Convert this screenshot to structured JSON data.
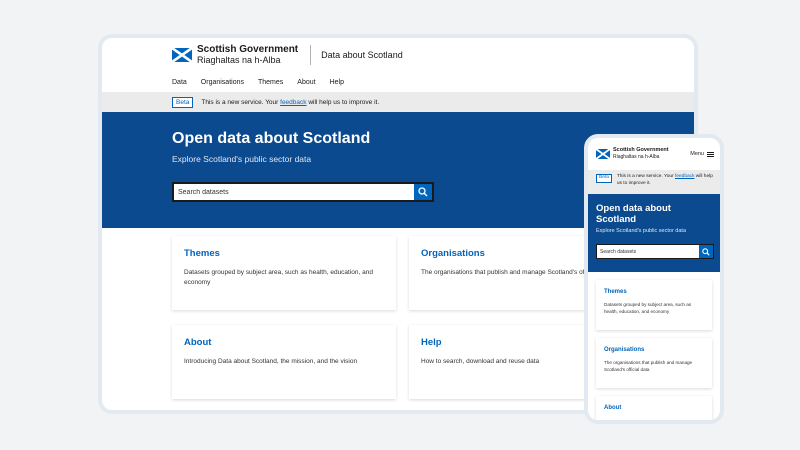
{
  "brand": {
    "name_en": "Scottish Government",
    "name_gd": "Riaghaltas na h-Alba",
    "site_title": "Data about Scotland"
  },
  "nav": {
    "items": [
      "Data",
      "Organisations",
      "Themes",
      "About",
      "Help"
    ]
  },
  "beta": {
    "tag": "Beta",
    "text_before": "This is a new service. Your ",
    "link": "feedback",
    "text_after": " will help us to improve it."
  },
  "hero": {
    "title": "Open data about Scotland",
    "subtitle": "Explore Scotland's public sector data",
    "search_placeholder": "Search datasets"
  },
  "cards": [
    {
      "title": "Themes",
      "desc": "Datasets grouped by subject area, such as health, education, and economy"
    },
    {
      "title": "Organisations",
      "desc": "The organisations that publish and manage Scotland's official data"
    },
    {
      "title": "About",
      "desc": "Introducing Data about Scotland, the mission, and the vision"
    },
    {
      "title": "Help",
      "desc": "How to search, download and reuse data"
    }
  ],
  "mobile": {
    "menu_label": "Menu"
  },
  "icons": {
    "search": "search-icon",
    "flag": "saltire-flag-icon",
    "menu": "hamburger-icon"
  },
  "colors": {
    "brand_blue": "#0065bd",
    "hero_blue": "#0b4a8f",
    "beta_bar": "#ebebeb",
    "frame": "#e2e9f0",
    "background": "#f1f3f5"
  }
}
